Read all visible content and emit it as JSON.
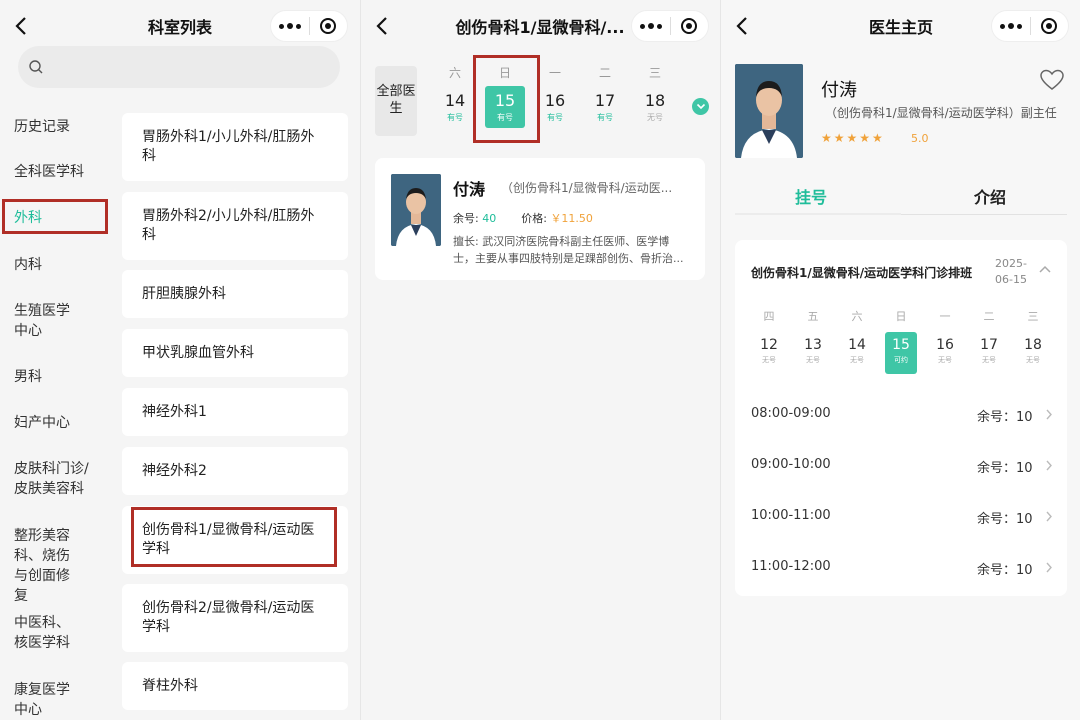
{
  "panel1": {
    "title": "科室列表",
    "categories": [
      "历史记录",
      "全科医学科",
      "外科",
      "内科",
      "生殖医学中心",
      "男科",
      "妇产中心",
      "皮肤科门诊/皮肤美容科",
      "整形美容科、烧伤与创面修复",
      "中医科、核医学科",
      "康复医学中心"
    ],
    "active_category": "外科",
    "departments": [
      "胃肠外科1/小儿外科/肛肠外科",
      "胃肠外科2/小儿外科/肛肠外科",
      "肝胆胰腺外科",
      "甲状乳腺血管外科",
      "神经外科1",
      "神经外科2",
      "创伤骨科1/显微骨科/运动医学科",
      "创伤骨科2/显微骨科/运动医学科",
      "脊柱外科"
    ],
    "highlighted_department": "创伤骨科1/显微骨科/运动医学科"
  },
  "panel2": {
    "title": "创伤骨科1/显微骨科/...",
    "all_doctors_label": "全部医生",
    "days": [
      {
        "weekday": "六",
        "date": "14",
        "status": "有号",
        "available": true
      },
      {
        "weekday": "日",
        "date": "15",
        "status": "有号",
        "available": true,
        "selected": true
      },
      {
        "weekday": "一",
        "date": "16",
        "status": "有号",
        "available": true
      },
      {
        "weekday": "二",
        "date": "17",
        "status": "有号",
        "available": true
      },
      {
        "weekday": "三",
        "date": "18",
        "status": "无号",
        "available": false
      }
    ],
    "doctor": {
      "name": "付涛",
      "dept": "（创伤骨科1/显微骨科/运动医...",
      "remain_label": "余号:",
      "remain_value": "40",
      "price_label": "价格:",
      "price_value": "￥11.50",
      "skill_label": "擅长:",
      "skill": "武汉同济医院骨科副主任医师、医学博士，主要从事四肢特别是足踝部创伤、骨折治..."
    }
  },
  "panel3": {
    "title": "医生主页",
    "doctor_name": "付涛",
    "doctor_dept": "（创伤骨科1/显微骨科/运动医学科）副主任",
    "stars": "★★★★★",
    "score": "5.0",
    "tabs": [
      "挂号",
      "介绍"
    ],
    "schedule_title": "创伤骨科1/显微骨科/运动医学科门诊排班",
    "schedule_date": "2025-06-15",
    "days": [
      {
        "weekday": "四",
        "date": "12",
        "status": "无号"
      },
      {
        "weekday": "五",
        "date": "13",
        "status": "无号"
      },
      {
        "weekday": "六",
        "date": "14",
        "status": "无号"
      },
      {
        "weekday": "日",
        "date": "15",
        "status": "可约",
        "selected": true
      },
      {
        "weekday": "一",
        "date": "16",
        "status": "无号"
      },
      {
        "weekday": "二",
        "date": "17",
        "status": "无号"
      },
      {
        "weekday": "三",
        "date": "18",
        "status": "无号"
      }
    ],
    "slots": [
      {
        "time": "08:00-09:00",
        "remain": "余号：10"
      },
      {
        "time": "09:00-10:00",
        "remain": "余号：10"
      },
      {
        "time": "10:00-11:00",
        "remain": "余号：10"
      },
      {
        "time": "11:00-12:00",
        "remain": "余号：10"
      }
    ]
  },
  "colors": {
    "accent": "#3fc6a6",
    "accent_text": "#1fbd9a",
    "highlight_box": "#b02e26",
    "price": "#f0a23a"
  }
}
